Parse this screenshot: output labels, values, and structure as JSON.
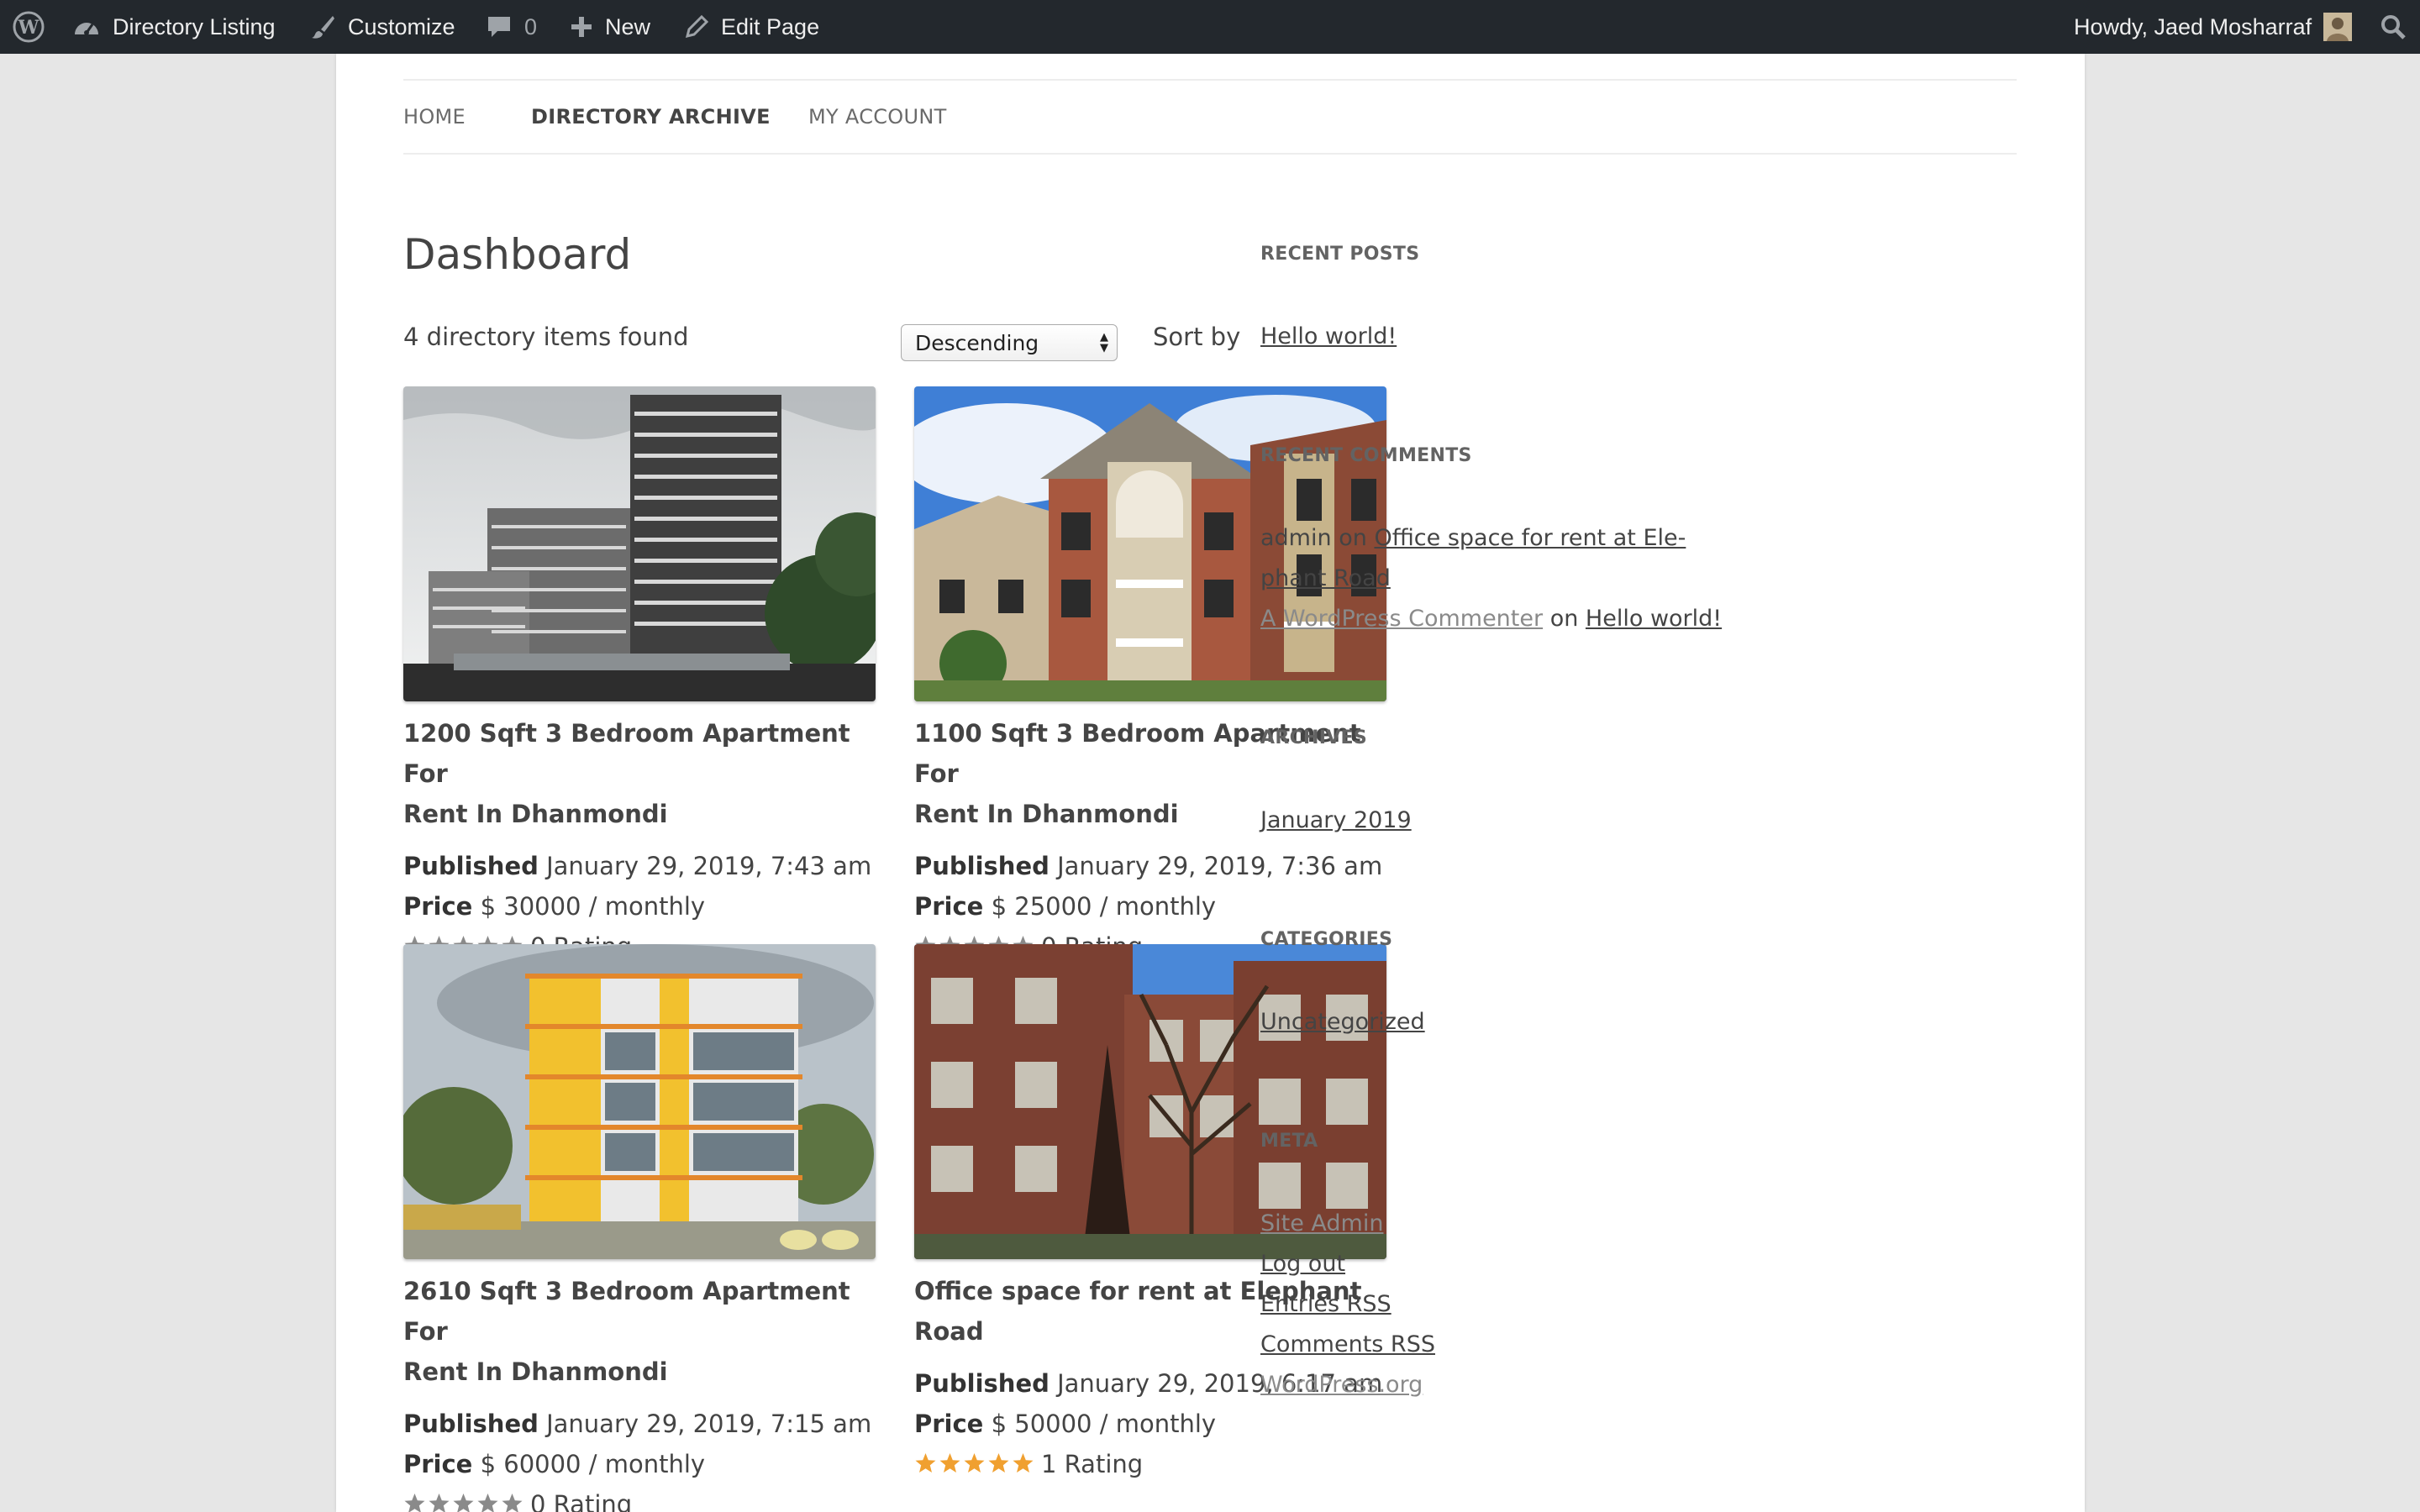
{
  "admin_bar": {
    "site_name": "Directory Listing",
    "customize": "Customize",
    "comments_count": "0",
    "new": "New",
    "edit_page": "Edit Page",
    "howdy": "Howdy, Jaed Mosharraf"
  },
  "nav": {
    "items": [
      "HOME",
      "DIRECTORY ARCHIVE",
      "MY ACCOUNT"
    ],
    "active": "DIRECTORY ARCHIVE"
  },
  "main": {
    "title": "Dashboard",
    "found": "4 directory items found",
    "sort_label": "Sort by",
    "sort_value": "Descending",
    "published_label": "Published",
    "price_label": "Price",
    "listings": [
      {
        "title_l1": "1200 Sqft 3 Bedroom Apartment For",
        "title_l2": "Rent In Dhanmondi",
        "published": "January 29, 2019, 7:43 am",
        "price": "$ 30000 / monthly",
        "rating_text": "0 Rating",
        "stars_filled": 0
      },
      {
        "title_l1": "1100 Sqft 3 Bedroom Apartment For",
        "title_l2": "Rent In Dhanmondi",
        "published": "January 29, 2019, 7:36 am",
        "price": "$ 25000 / monthly",
        "rating_text": "0 Rating",
        "stars_filled": 0
      },
      {
        "title_l1": "2610 Sqft 3 Bedroom Apartment For",
        "title_l2": "Rent In Dhanmondi",
        "published": "January 29, 2019, 7:15 am",
        "price": "$ 60000 / monthly",
        "rating_text": "0 Rating",
        "stars_filled": 0
      },
      {
        "title_l1": "Office space for rent at Elephant Road",
        "title_l2": "",
        "published": "January 29, 2019, 6:17 am",
        "price": "$ 50000 / monthly",
        "rating_text": "1 Rating",
        "stars_filled": 5
      }
    ]
  },
  "sidebar": {
    "recent_posts_heading": "RECENT POSTS",
    "recent_posts": [
      "Hello world!"
    ],
    "recent_comments_heading": "RECENT COMMENTS",
    "comment1_author": "admin",
    "comment1_on": "on",
    "comment1_post_l1": "Office space for rent at Ele-",
    "comment1_post_l2": "phant Road",
    "comment2_author": "A WordPress Commenter",
    "comment2_on": "on",
    "comment2_post": "Hello world!",
    "archives_heading": "ARCHIVES",
    "archives": [
      "January 2019"
    ],
    "categories_heading": "CATEGORIES",
    "categories": [
      "Uncategorized"
    ],
    "meta_heading": "META",
    "meta_links": [
      "Site Admin",
      "Log out",
      "Entries RSS",
      "Comments RSS",
      "WordPress.org"
    ]
  },
  "colors": {
    "admin_bar_bg": "#23282d",
    "star_filled": "#f0a030",
    "star_empty": "#8a8a8a",
    "page_bg": "#e6e6e6"
  }
}
